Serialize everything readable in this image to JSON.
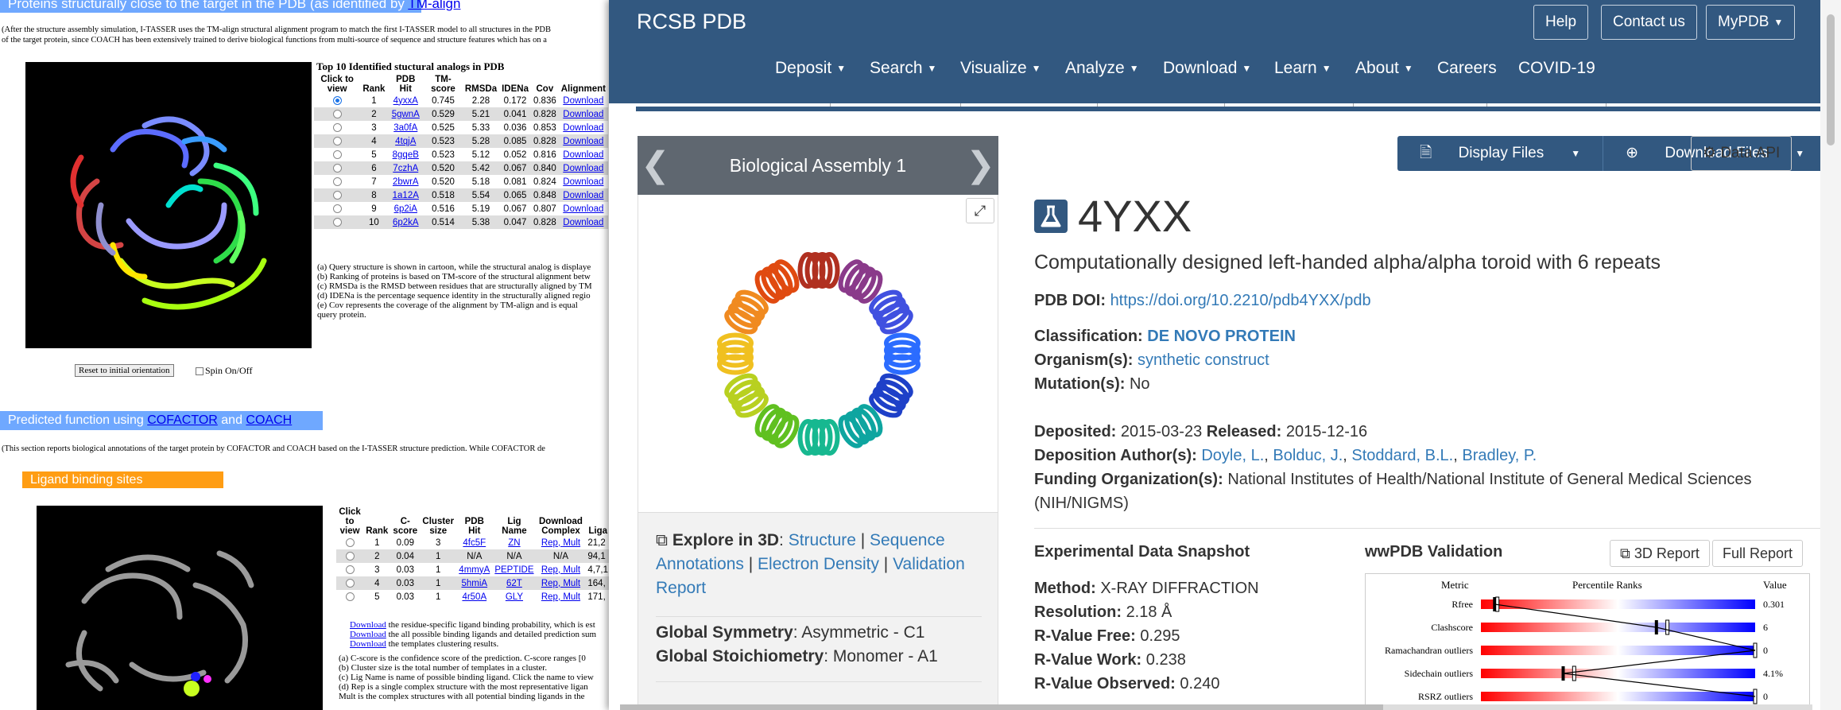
{
  "left": {
    "heading1_prefix": "Proteins structurally close to the target in the PDB (as identified by ",
    "heading1_link": "TM-align",
    "heading1_suffix": ")",
    "intro_note_1": "(After the structure assembly simulation, I-TASSER uses the TM-align structural alignment program to match the first I-TASSER model to all structures in the PDB",
    "intro_note_2": "of the target protein, since COACH has been extensively trained to derive biological functions from multi-source of sequence and structure features which has on a",
    "table_title": "Top 10 Identified stuctural analogs in PDB",
    "table_headers": [
      "Click to view",
      "Rank",
      "PDB Hit",
      "TM-score",
      "RMSDa",
      "IDENa",
      "Cov",
      "Alignment"
    ],
    "rows": [
      {
        "rank": "1",
        "hit": "4yxxA",
        "tm": "0.745",
        "rmsd": "2.28",
        "iden": "0.172",
        "cov": "0.836",
        "aln": "Download",
        "selected": true
      },
      {
        "rank": "2",
        "hit": "5gwnA",
        "tm": "0.529",
        "rmsd": "5.21",
        "iden": "0.041",
        "cov": "0.828",
        "aln": "Download"
      },
      {
        "rank": "3",
        "hit": "3a0fA",
        "tm": "0.525",
        "rmsd": "5.33",
        "iden": "0.036",
        "cov": "0.853",
        "aln": "Download"
      },
      {
        "rank": "4",
        "hit": "4tqjA",
        "tm": "0.523",
        "rmsd": "5.28",
        "iden": "0.085",
        "cov": "0.828",
        "aln": "Download"
      },
      {
        "rank": "5",
        "hit": "8gqeB",
        "tm": "0.523",
        "rmsd": "5.12",
        "iden": "0.052",
        "cov": "0.816",
        "aln": "Download"
      },
      {
        "rank": "6",
        "hit": "7czhA",
        "tm": "0.520",
        "rmsd": "5.42",
        "iden": "0.067",
        "cov": "0.840",
        "aln": "Download"
      },
      {
        "rank": "7",
        "hit": "2bwrA",
        "tm": "0.520",
        "rmsd": "5.18",
        "iden": "0.081",
        "cov": "0.824",
        "aln": "Download"
      },
      {
        "rank": "8",
        "hit": "1a12A",
        "tm": "0.518",
        "rmsd": "5.54",
        "iden": "0.065",
        "cov": "0.848",
        "aln": "Download"
      },
      {
        "rank": "9",
        "hit": "6p2iA",
        "tm": "0.516",
        "rmsd": "5.19",
        "iden": "0.067",
        "cov": "0.807",
        "aln": "Download"
      },
      {
        "rank": "10",
        "hit": "6p2kA",
        "tm": "0.514",
        "rmsd": "5.38",
        "iden": "0.047",
        "cov": "0.828",
        "aln": "Download"
      }
    ],
    "footnotes": [
      "(a) Query structure is shown in cartoon, while the structural analog is displaye",
      "(b) Ranking of proteins is based on TM-score of the structural alignment betw",
      "(c) RMSDa is the RMSD between residues that are structurally aligned by TM",
      "(d) IDENa is the percentage sequence identity in the structurally aligned regio",
      "(e) Cov represents the coverage of the alignment by TM-align and is equal",
      "     query protein."
    ],
    "reset_button": "Reset to initial orientation",
    "spin_label": "Spin On/Off",
    "heading2_prefix": "Predicted function using ",
    "heading2_link1": "COFACTOR",
    "heading2_mid": " and ",
    "heading2_link2": "COACH",
    "func_note": "(This section reports biological annotations of the target protein by COFACTOR and COACH based on the I-TASSER structure prediction. While COFACTOR de",
    "ligand_heading": "Ligand binding sites",
    "lig_headers": [
      "Click to view",
      "Rank",
      "C-score",
      "Cluster size",
      "PDB Hit",
      "Lig Name",
      "Download Complex",
      "Liga"
    ],
    "lig_rows": [
      {
        "rank": "1",
        "c": "0.09",
        "size": "3",
        "hit": "4fc5F",
        "lig": "ZN",
        "dl": "Rep, Mult",
        "site": "21,2"
      },
      {
        "rank": "2",
        "c": "0.04",
        "size": "1",
        "hit": "N/A",
        "lig": "N/A",
        "dl": "N/A",
        "site": "94,1"
      },
      {
        "rank": "3",
        "c": "0.03",
        "size": "1",
        "hit": "4mmyA",
        "lig": "PEPTIDE",
        "dl": "Rep, Mult",
        "site": "4,7,1"
      },
      {
        "rank": "4",
        "c": "0.03",
        "size": "1",
        "hit": "5hmiA",
        "lig": "62T",
        "dl": "Rep, Mult",
        "site": "164,"
      },
      {
        "rank": "5",
        "c": "0.03",
        "size": "1",
        "hit": "4r50A",
        "lig": "GLY",
        "dl": "Rep, Mult",
        "site": "171,"
      }
    ],
    "lig_notes": [
      {
        "link": "Download",
        "text": " the residue-specific ligand binding probability, which is est"
      },
      {
        "link": "Download",
        "text": " the all possible binding ligands and detailed prediction sum"
      },
      {
        "link": "Download",
        "text": " the templates clustering results."
      }
    ],
    "lig_footnotes": [
      "(a) C-score is the confidence score of the prediction. C-score ranges [0",
      "(b) Cluster size is the total number of templates in a cluster.",
      "(c) Lig Name is name of possible binding ligand. Click the name to view",
      "(d) Rep is a single complex structure with the most representative ligan",
      "     Mult is the complex structures with all potential binding ligands in the"
    ]
  },
  "rcsb": {
    "brand": "RCSB PDB",
    "top_buttons": [
      "Help",
      "Contact us",
      "MyPDB"
    ],
    "menu": [
      "Deposit",
      "Search",
      "Visualize",
      "Analyze",
      "Download",
      "Learn",
      "About",
      "Careers",
      "COVID-19"
    ],
    "assembly_label": "Biological Assembly 1",
    "display_files": "Display Files",
    "download_files": "Download Files",
    "data_api": "Data API",
    "pdb_id": "4YXX",
    "title": "Computationally designed left-handed alpha/alpha toroid with 6 repeats",
    "doi_label": "PDB DOI:",
    "doi": "https://doi.org/10.2210/pdb4YXX/pdb",
    "classification_label": "Classification:",
    "classification": "DE NOVO PROTEIN",
    "organism_label": "Organism(s):",
    "organism": "synthetic construct",
    "mutation_label": "Mutation(s):",
    "mutation": "No",
    "deposited_label": "Deposited:",
    "deposited": "2015-03-23",
    "released_label": "Released:",
    "released": "2015-12-16",
    "authors_label": "Deposition Author(s):",
    "authors": [
      "Doyle, L.",
      "Bolduc, J.",
      "Stoddard, B.L.",
      "Bradley, P."
    ],
    "funding_label": "Funding Organization(s):",
    "funding_1": "National Institutes of Health/National Institute of General Medical Sciences",
    "funding_2": "(NIH/NIGMS)",
    "explore_label": "Explore in 3D",
    "explore_links": [
      "Structure",
      "Sequence",
      "Annotations",
      "Electron Density",
      "Validation Report"
    ],
    "global_sym_label": "Global Symmetry",
    "global_sym": "Asymmetric - C1",
    "global_stoich_label": "Global Stoichiometry",
    "global_stoich": "Monomer - A1",
    "exp_head": "Experimental Data Snapshot",
    "method_label": "Method:",
    "method": "X-RAY DIFFRACTION",
    "resolution_label": "Resolution:",
    "resolution": "2.18 Å",
    "rfree_label": "R-Value Free:",
    "rfree": "0.295",
    "rwork_label": "R-Value Work:",
    "rwork": "0.238",
    "robs_label": "R-Value Observed:",
    "robs": "0.240",
    "wwpdb_head": "wwPDB Validation",
    "report_3d": "3D Report",
    "report_full": "Full Report",
    "val_headers": [
      "Metric",
      "Percentile Ranks",
      "Value"
    ],
    "val_rows": [
      {
        "metric": "Rfree",
        "value": "0.301",
        "pct": 0.05,
        "pct2": 0.06
      },
      {
        "metric": "Clashscore",
        "value": "6",
        "pct": 0.64,
        "pct2": 0.68
      },
      {
        "metric": "Ramachandran outliers",
        "value": "0",
        "pct": 1.0,
        "pct2": 1.0
      },
      {
        "metric": "Sidechain outliers",
        "value": "4.1%",
        "pct": 0.3,
        "pct2": 0.34
      },
      {
        "metric": "RSRZ outliers",
        "value": "0",
        "pct": 1.0,
        "pct2": 1.0
      }
    ]
  }
}
